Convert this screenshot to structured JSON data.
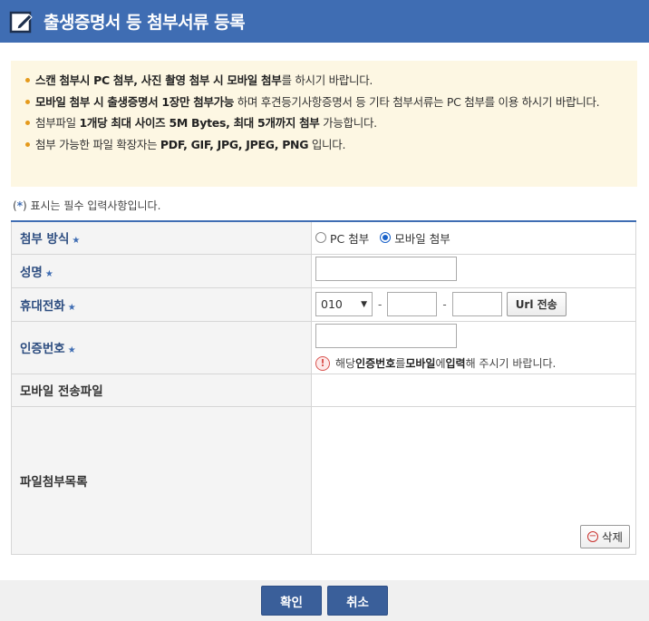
{
  "header": {
    "title": "출생증명서 등 첨부서류 등록"
  },
  "notice": {
    "items": [
      {
        "parts": [
          {
            "b": "스캔 첨부시 PC 첨부, 사진 촬영 첨부 시 모바일 첨부"
          },
          {
            "t": "를 하시기 바랍니다."
          }
        ]
      },
      {
        "parts": [
          {
            "b": "모바일 첨부 시 출생증명서 1장만 첨부가능"
          },
          {
            "t": " 하며 후견등기사항증명서 등 기타 첨부서류는 PC 첨부를 이용 하시기 바랍니다."
          }
        ]
      },
      {
        "parts": [
          {
            "t": "첨부파일 "
          },
          {
            "b": "1개당 최대 사이즈 5M Bytes, 최대 5개까지 첨부"
          },
          {
            "t": " 가능합니다."
          }
        ]
      },
      {
        "parts": [
          {
            "t": "첨부 가능한 파일 확장자는 "
          },
          {
            "b": "PDF, GIF, JPG, JPEG, PNG"
          },
          {
            "t": " 입니다."
          }
        ]
      }
    ]
  },
  "required_note": {
    "open": "(",
    "mark": "*",
    "close": ")",
    "text": " 표시는 필수 입력사항입니다."
  },
  "form": {
    "attach_method": {
      "label": "첨부 방식",
      "options": [
        {
          "label": "PC 첨부",
          "checked": false
        },
        {
          "label": "모바일 첨부",
          "checked": true
        }
      ]
    },
    "name": {
      "label": "성명",
      "value": ""
    },
    "phone": {
      "label": "휴대전화",
      "prefix": "010",
      "mid": "",
      "last": "",
      "dash": "-",
      "url_button": "Url 전송"
    },
    "auth": {
      "label": "인증번호",
      "value": "",
      "warning_pre": "해당 ",
      "warning_b1": "인증번호",
      "warning_mid": "를 ",
      "warning_b2": "모바일",
      "warning_mid2": "에 ",
      "warning_b3": "입력",
      "warning_post": "해 주시기 바랍니다."
    },
    "mobile_file": {
      "label": "모바일 전송파일"
    },
    "file_list": {
      "label": "파일첨부목록",
      "delete_button": "삭제"
    }
  },
  "footer": {
    "confirm": "확인",
    "cancel": "취소"
  },
  "colors": {
    "header": "#3f6db3",
    "notice_bg": "#fdf7e3",
    "bullet": "#e59a1c",
    "button": "#3a5f9a"
  }
}
